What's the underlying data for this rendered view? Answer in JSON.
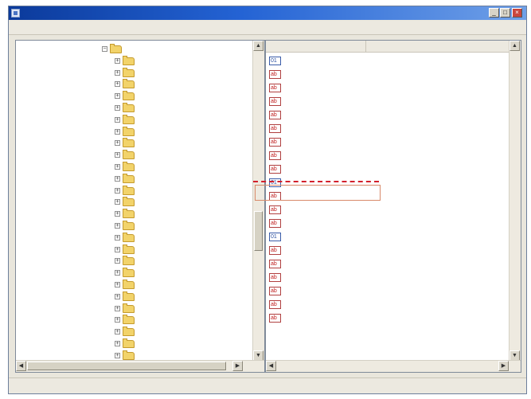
{
  "window": {
    "title": "",
    "minimize_glyph": "_",
    "maximize_glyph": "□",
    "close_glyph": "×",
    "titlebar_color": "#2463d4"
  },
  "menu": [
    {
      "label": ""
    },
    {
      "label": ""
    },
    {
      "label": ""
    },
    {
      "label": ""
    }
  ],
  "tree": {
    "expand_glyph": "+",
    "collapse_glyph": "−",
    "items": [
      {
        "label": ""
      },
      {
        "label": ""
      },
      {
        "label": ""
      },
      {
        "label": ""
      },
      {
        "label": ""
      },
      {
        "label": ""
      },
      {
        "label": ""
      },
      {
        "label": ""
      },
      {
        "label": ""
      },
      {
        "label": ""
      },
      {
        "label": ""
      },
      {
        "label": ""
      },
      {
        "label": ""
      },
      {
        "label": ""
      },
      {
        "label": ""
      },
      {
        "label": ""
      },
      {
        "label": ""
      },
      {
        "label": ""
      },
      {
        "label": ""
      },
      {
        "label": ""
      },
      {
        "label": ""
      },
      {
        "label": ""
      },
      {
        "label": ""
      },
      {
        "label": ""
      },
      {
        "label": ""
      },
      {
        "label": ""
      },
      {
        "label": ""
      }
    ]
  },
  "values": {
    "headers": {
      "name": "",
      "data": ""
    },
    "rows": [
      {
        "type": "bin",
        "name": "",
        "data": ""
      },
      {
        "type": "sz",
        "name": "",
        "data": ""
      },
      {
        "type": "sz",
        "name": "",
        "data": ""
      },
      {
        "type": "sz",
        "name": "",
        "data": ""
      },
      {
        "type": "sz",
        "name": "",
        "data": ""
      },
      {
        "type": "sz",
        "name": "",
        "data": ""
      },
      {
        "type": "sz",
        "name": "",
        "data": ""
      },
      {
        "type": "sz",
        "name": "",
        "data": ""
      },
      {
        "type": "sz",
        "name": "",
        "data": ""
      },
      {
        "type": "bin",
        "name": "",
        "data": ""
      },
      {
        "type": "sz",
        "name": "",
        "data": ""
      },
      {
        "type": "sz",
        "name": "",
        "data": ""
      },
      {
        "type": "sz",
        "name": "",
        "data": ""
      },
      {
        "type": "bin",
        "name": "",
        "data": ""
      },
      {
        "type": "sz",
        "name": "",
        "data": ""
      },
      {
        "type": "sz",
        "name": "",
        "data": ""
      },
      {
        "type": "sz",
        "name": "",
        "data": ""
      },
      {
        "type": "sz",
        "name": "",
        "data": ""
      },
      {
        "type": "sz",
        "name": "",
        "data": ""
      },
      {
        "type": "sz",
        "name": "",
        "data": ""
      }
    ]
  },
  "scroll_glyphs": {
    "up": "▲",
    "down": "▼",
    "left": "◀",
    "right": "▶"
  },
  "status": {
    "text": ""
  }
}
